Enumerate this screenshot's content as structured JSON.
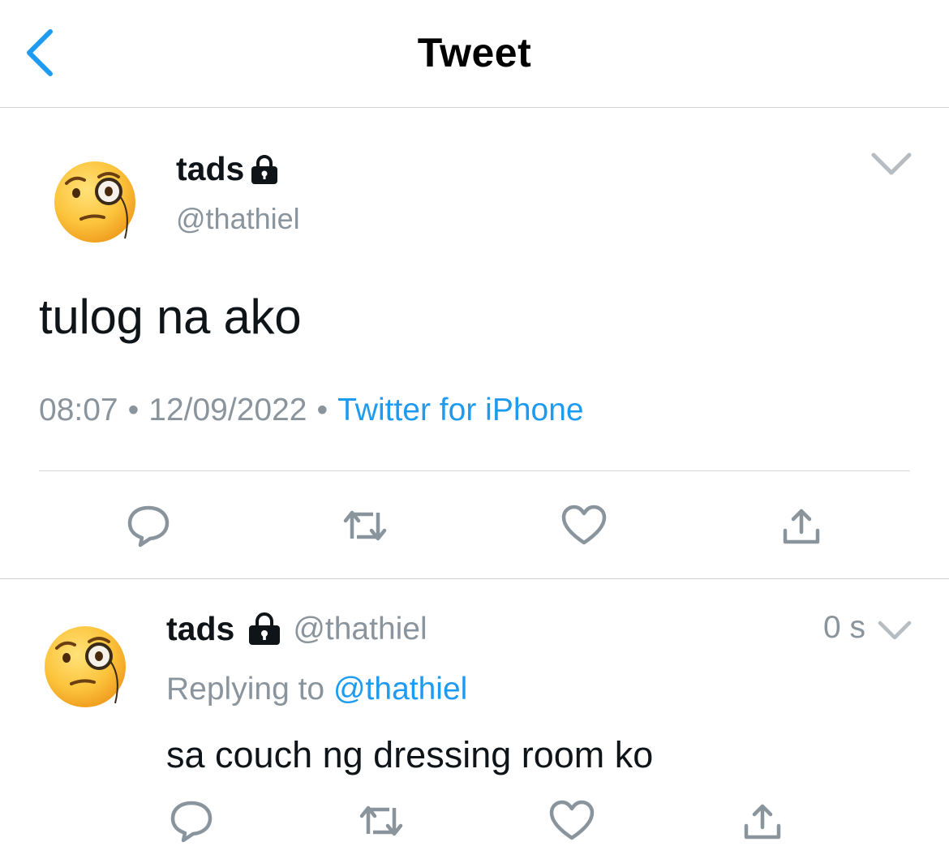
{
  "nav": {
    "title": "Tweet",
    "back_icon": "chevron-left-icon"
  },
  "colors": {
    "accent": "#1d9bf0",
    "secondary_text": "#8a949c",
    "primary_text": "#0f1419",
    "divider": "#cfd3d6",
    "icon_gray": "#8a949c"
  },
  "main_tweet": {
    "avatar_icon": "face-with-monocle-emoji",
    "name": "tads",
    "protected_icon": "lock-icon",
    "handle": "@thathiel",
    "text": "tulog na ako",
    "time": "08:07",
    "separator": "•",
    "date": "12/09/2022",
    "source": "Twitter for iPhone",
    "actions": [
      "reply-icon",
      "retweet-icon",
      "like-icon",
      "share-icon"
    ]
  },
  "reply_tweet": {
    "avatar_icon": "face-with-monocle-emoji",
    "name": "tads",
    "protected_icon": "lock-icon",
    "handle": "@thathiel",
    "timestamp": "0 s",
    "replying_label": "Replying to",
    "replying_to": "@thathiel",
    "text": "sa couch ng dressing room ko",
    "actions": [
      "reply-icon",
      "retweet-icon",
      "like-icon",
      "share-icon"
    ]
  }
}
